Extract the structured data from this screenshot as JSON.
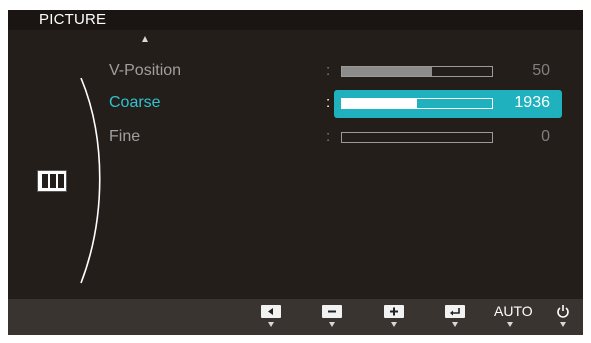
{
  "osd": {
    "title": "PICTURE",
    "items": [
      {
        "label": "V-Position",
        "value": "50",
        "level": 0.6,
        "selected": false
      },
      {
        "label": "Coarse",
        "value": "1936",
        "level": 0.5,
        "selected": true
      },
      {
        "label": "Fine",
        "value": "0",
        "level": 0.0,
        "selected": false
      }
    ],
    "category_icon": "picture-category-icon",
    "footer": {
      "buttons": [
        {
          "name": "left-arrow-button",
          "icon": "left-triangle-icon"
        },
        {
          "name": "minus-button",
          "icon": "minus-icon"
        },
        {
          "name": "plus-button",
          "icon": "plus-icon"
        },
        {
          "name": "enter-button",
          "icon": "enter-icon"
        },
        {
          "name": "auto-button",
          "label": "AUTO"
        },
        {
          "name": "power-button",
          "icon": "power-icon"
        }
      ]
    },
    "colors": {
      "background": "#241e1b",
      "highlight": "#1fb2be",
      "selected_label": "#2fc2cf",
      "normal_text": "#9f9f9f"
    }
  }
}
